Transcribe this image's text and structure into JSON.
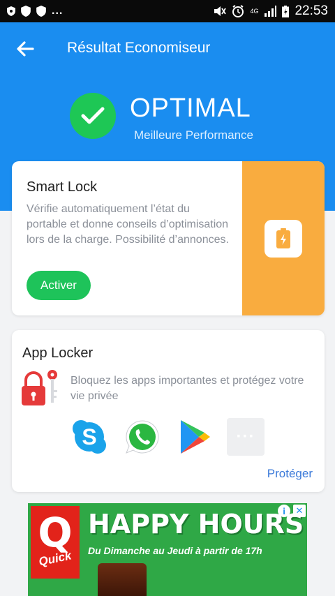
{
  "status_bar": {
    "time": "22:53",
    "network_label": "4G",
    "overflow_dots": "..."
  },
  "header": {
    "title": "Résultat Economiseur",
    "status_title": "OPTIMAL",
    "status_subtitle": "Meilleure Performance",
    "background_color": "#1a8df0"
  },
  "smart_lock": {
    "title": "Smart Lock",
    "description": "Vérifie automatiquement l’état du portable et donne conseils d’optimisation lors de la charge. Possibilité d’annonces.",
    "button_label": "Activer",
    "accent_color": "#f9ac3f",
    "icon": "battery-charging-icon"
  },
  "app_locker": {
    "title": "App Locker",
    "description": "Bloquez les apps importantes et protégez votre vie privée",
    "apps": [
      {
        "icon": "skype-icon"
      },
      {
        "icon": "whatsapp-icon"
      },
      {
        "icon": "google-play-icon"
      },
      {
        "icon": "more-icon",
        "label": "···"
      }
    ],
    "action_label": "Protéger"
  },
  "ad": {
    "logo_letter": "Q",
    "logo_text": "Quick",
    "headline": "HAPPY HOURS",
    "subline": "Du Dimanche au Jeudi à partir de 17h",
    "info_icon": "i",
    "close_icon": "✕"
  }
}
